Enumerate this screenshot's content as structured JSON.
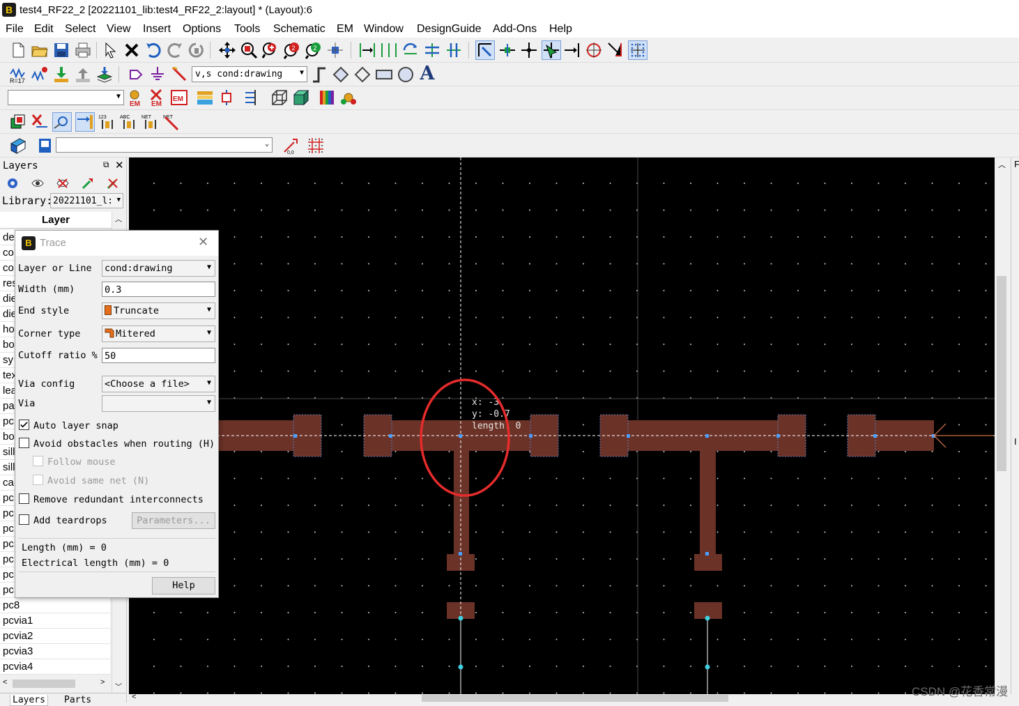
{
  "window": {
    "title": "test4_RF22_2 [20221101_lib:test4_RF22_2:layout] * (Layout):6",
    "app_icon_glyph": "B"
  },
  "menu": [
    "File",
    "Edit",
    "Select",
    "View",
    "Insert",
    "Options",
    "Tools",
    "Schematic",
    "EM",
    "Window",
    "DesignGuide",
    "Add-Ons",
    "Help"
  ],
  "toolbar": {
    "layer_combo": "v,s cond:drawing",
    "combo_row3": "",
    "combo_row5": "",
    "labels": {
      "r17": "R=17",
      "em1": "EM",
      "em2": "EM",
      "em3": "EM",
      "num123": "123",
      "abc": "ABC",
      "net1": "NET",
      "net2": "NET",
      "text_a": "A"
    }
  },
  "layers_panel": {
    "title": "Layers",
    "library_label": "Library:",
    "library_value": "20221101_l:",
    "column_header": "Layer",
    "truncated_rows": [
      "de",
      "co",
      "co",
      "res",
      "die",
      "die",
      "ho",
      "bo",
      "sy",
      "tex",
      "lea",
      "pa",
      "pc",
      "bo",
      "sill",
      "sill",
      "ca",
      "pc",
      "pc",
      "pc",
      "pc",
      "pc",
      "pc",
      "pc"
    ],
    "rows": [
      "pc8",
      "pcvia1",
      "pcvia2",
      "pcvia3",
      "pcvia4"
    ],
    "bottom_tabs": [
      "Layers",
      "Parts"
    ]
  },
  "trace_dialog": {
    "title": "Trace",
    "layer_label": "Layer or Line",
    "layer_value": "cond:drawing",
    "width_label": "Width (mm)",
    "width_value": "0.3",
    "end_style_label": "End style",
    "end_style_value": "Truncate",
    "corner_type_label": "Corner type",
    "corner_type_value": "Mitered",
    "cutoff_label": "Cutoff ratio %",
    "cutoff_value": "50",
    "via_config_label": "Via config",
    "via_config_value": "<Choose a file>",
    "via_label": "Via",
    "via_value": "",
    "auto_layer_snap": {
      "label": "Auto layer snap",
      "checked": true
    },
    "avoid_obstacles": {
      "label": "Avoid obstacles when routing (H)",
      "checked": false
    },
    "follow_mouse": {
      "label": "Follow mouse",
      "checked": false
    },
    "avoid_same_net": {
      "label": "Avoid same net (N)",
      "checked": false
    },
    "remove_redundant": {
      "label": "Remove redundant interconnects",
      "checked": false
    },
    "add_teardrops": {
      "label": "Add teardrops",
      "checked": false
    },
    "parameters_button": "Parameters...",
    "length_readout": "Length (mm) = 0",
    "electrical_length_readout": "Electrical length (mm) = 0",
    "help_button": "Help"
  },
  "canvas": {
    "readout_x": "x: -3",
    "readout_y": "y: -0.7",
    "readout_length": "length: 0",
    "trace_color": "#6b3227",
    "annotation_color": "#e52b2b"
  },
  "right_panel": {
    "top_letter": "F",
    "bottom_letter": "I"
  },
  "watermark": "CSDN @花香常漫"
}
